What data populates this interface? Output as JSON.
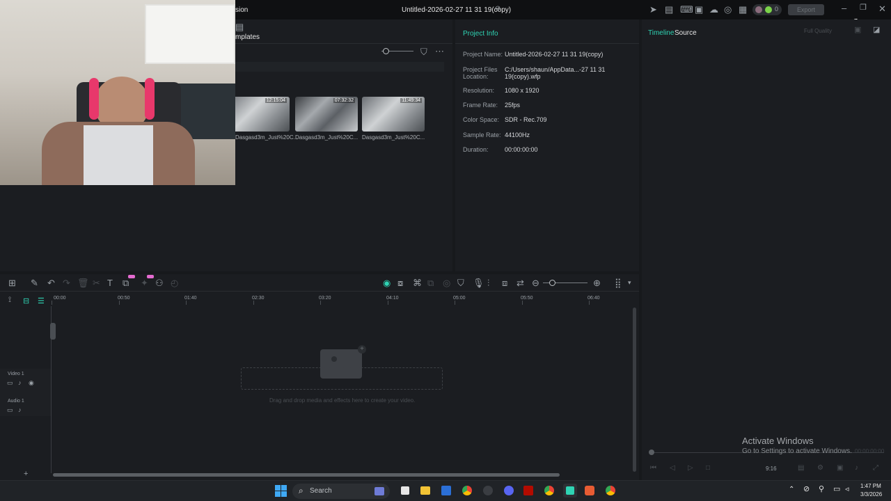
{
  "titlebar": {
    "version_label": "sion",
    "project_title": "Untitled-2026-02-27 11 31 19(copy)",
    "points": "0",
    "export_label": "Export"
  },
  "media": {
    "templates_tab": "mplates",
    "clips": [
      {
        "name": "Dasgasd3m_Just%20C...",
        "duration": "12:15:04"
      },
      {
        "name": "Dasgasd3m_Just%20C...",
        "duration": "07:32:32"
      },
      {
        "name": "Dasgasd3m_Just%20C...",
        "duration": "11:49:34"
      }
    ]
  },
  "project_info": {
    "title": "Project Info",
    "rows": [
      {
        "label": "Project Name:",
        "value": "Untitled-2026-02-27 11 31 19(copy)"
      },
      {
        "label": "Project Files Location:",
        "value": "C:/Users/shaun/AppData...-27 11 31 19(copy).wfp"
      },
      {
        "label": "Resolution:",
        "value": "1080 x 1920"
      },
      {
        "label": "Frame Rate:",
        "value": "25fps"
      },
      {
        "label": "Color Space:",
        "value": "SDR - Rec.709"
      },
      {
        "label": "Sample Rate:",
        "value": "44100Hz"
      },
      {
        "label": "Duration:",
        "value": "00:00:00:00"
      }
    ]
  },
  "preview": {
    "tab_timeline": "Timeline",
    "tab_source": "Source",
    "quality": "Full Quality",
    "aspect": "9:16",
    "timecode": "00:00:00:00"
  },
  "timeline": {
    "ruler": [
      "00:00",
      "00:50",
      "01:40",
      "02:30",
      "03:20",
      "04:10",
      "05:00",
      "05:50",
      "06:40"
    ],
    "track_video": "Video 1",
    "track_audio": "Audio 1",
    "drop_hint": "Drag and drop media and effects here to create your video."
  },
  "watermark": {
    "line1": "Activate Windows",
    "line2": "Go to Settings to activate Windows."
  },
  "taskbar": {
    "search": "Search",
    "time": "1:47 PM",
    "date": "3/3/2026"
  },
  "colors": {
    "accent": "#2fd4b4",
    "bg": "#17191c",
    "panel": "#1b1d21"
  }
}
